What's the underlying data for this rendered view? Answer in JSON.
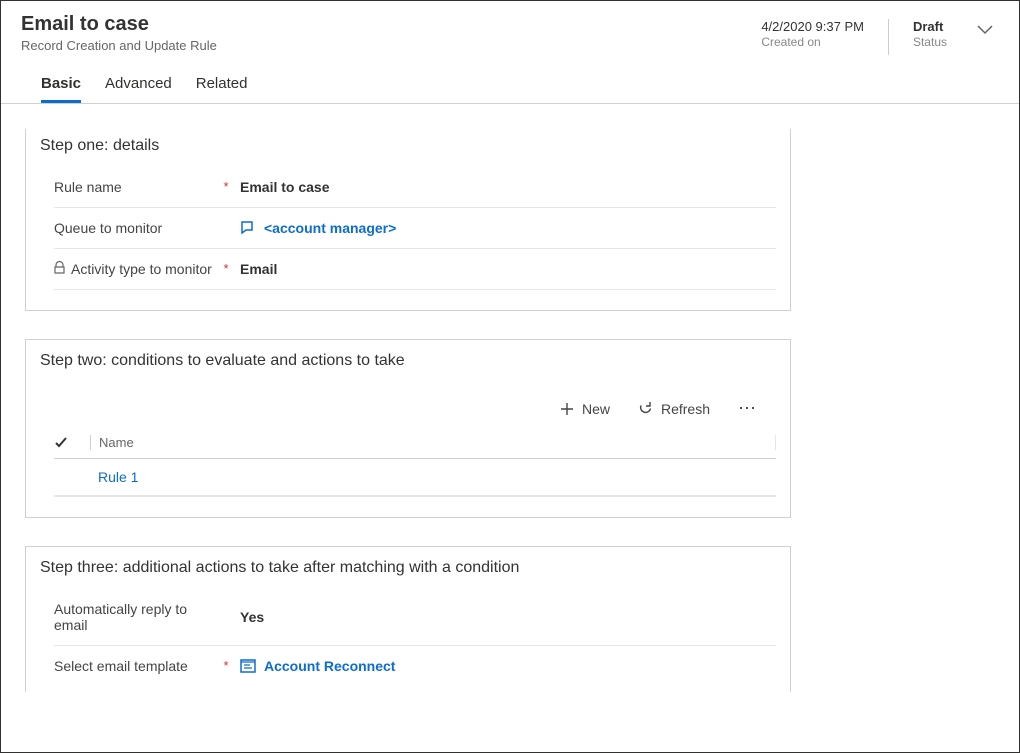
{
  "header": {
    "title": "Email to case",
    "subtitle": "Record Creation and Update Rule",
    "created_on_value": "4/2/2020 9:37 PM",
    "created_on_label": "Created on",
    "status_value": "Draft",
    "status_label": "Status"
  },
  "tabs": {
    "basic": "Basic",
    "advanced": "Advanced",
    "related": "Related"
  },
  "step1": {
    "title": "Step one: details",
    "rule_name_label": "Rule name",
    "rule_name_value": "Email to case",
    "queue_label": "Queue to monitor",
    "queue_value": "<account manager>",
    "activity_type_label": "Activity type to monitor",
    "activity_type_value": "Email"
  },
  "step2": {
    "title": "Step two: conditions to evaluate and actions to take",
    "new_label": "New",
    "refresh_label": "Refresh",
    "col_name": "Name",
    "rows": [
      {
        "name": "Rule 1"
      }
    ]
  },
  "step3": {
    "title": "Step three: additional actions to take after matching with a condition",
    "auto_reply_label": "Automatically reply to email",
    "auto_reply_value": "Yes",
    "template_label": "Select email template",
    "template_value": "Account Reconnect"
  }
}
